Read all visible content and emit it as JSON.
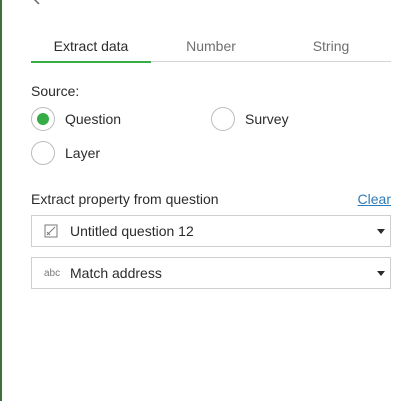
{
  "tabs": [
    {
      "label": "Extract data",
      "active": true
    },
    {
      "label": "Number",
      "active": false
    },
    {
      "label": "String",
      "active": false
    }
  ],
  "source": {
    "label": "Source:",
    "options": [
      {
        "label": "Question",
        "checked": true
      },
      {
        "label": "Survey",
        "checked": false
      },
      {
        "label": "Layer",
        "checked": false
      }
    ]
  },
  "extract": {
    "label": "Extract property from question",
    "clear_label": "Clear",
    "question_select": {
      "icon": "question-type-icon",
      "value": "Untitled question 12"
    },
    "property_select": {
      "icon": "abc",
      "value": "Match address"
    }
  },
  "colors": {
    "accent": "#35ac46",
    "link": "#2f7bb6",
    "border": "#3f6f3a"
  }
}
